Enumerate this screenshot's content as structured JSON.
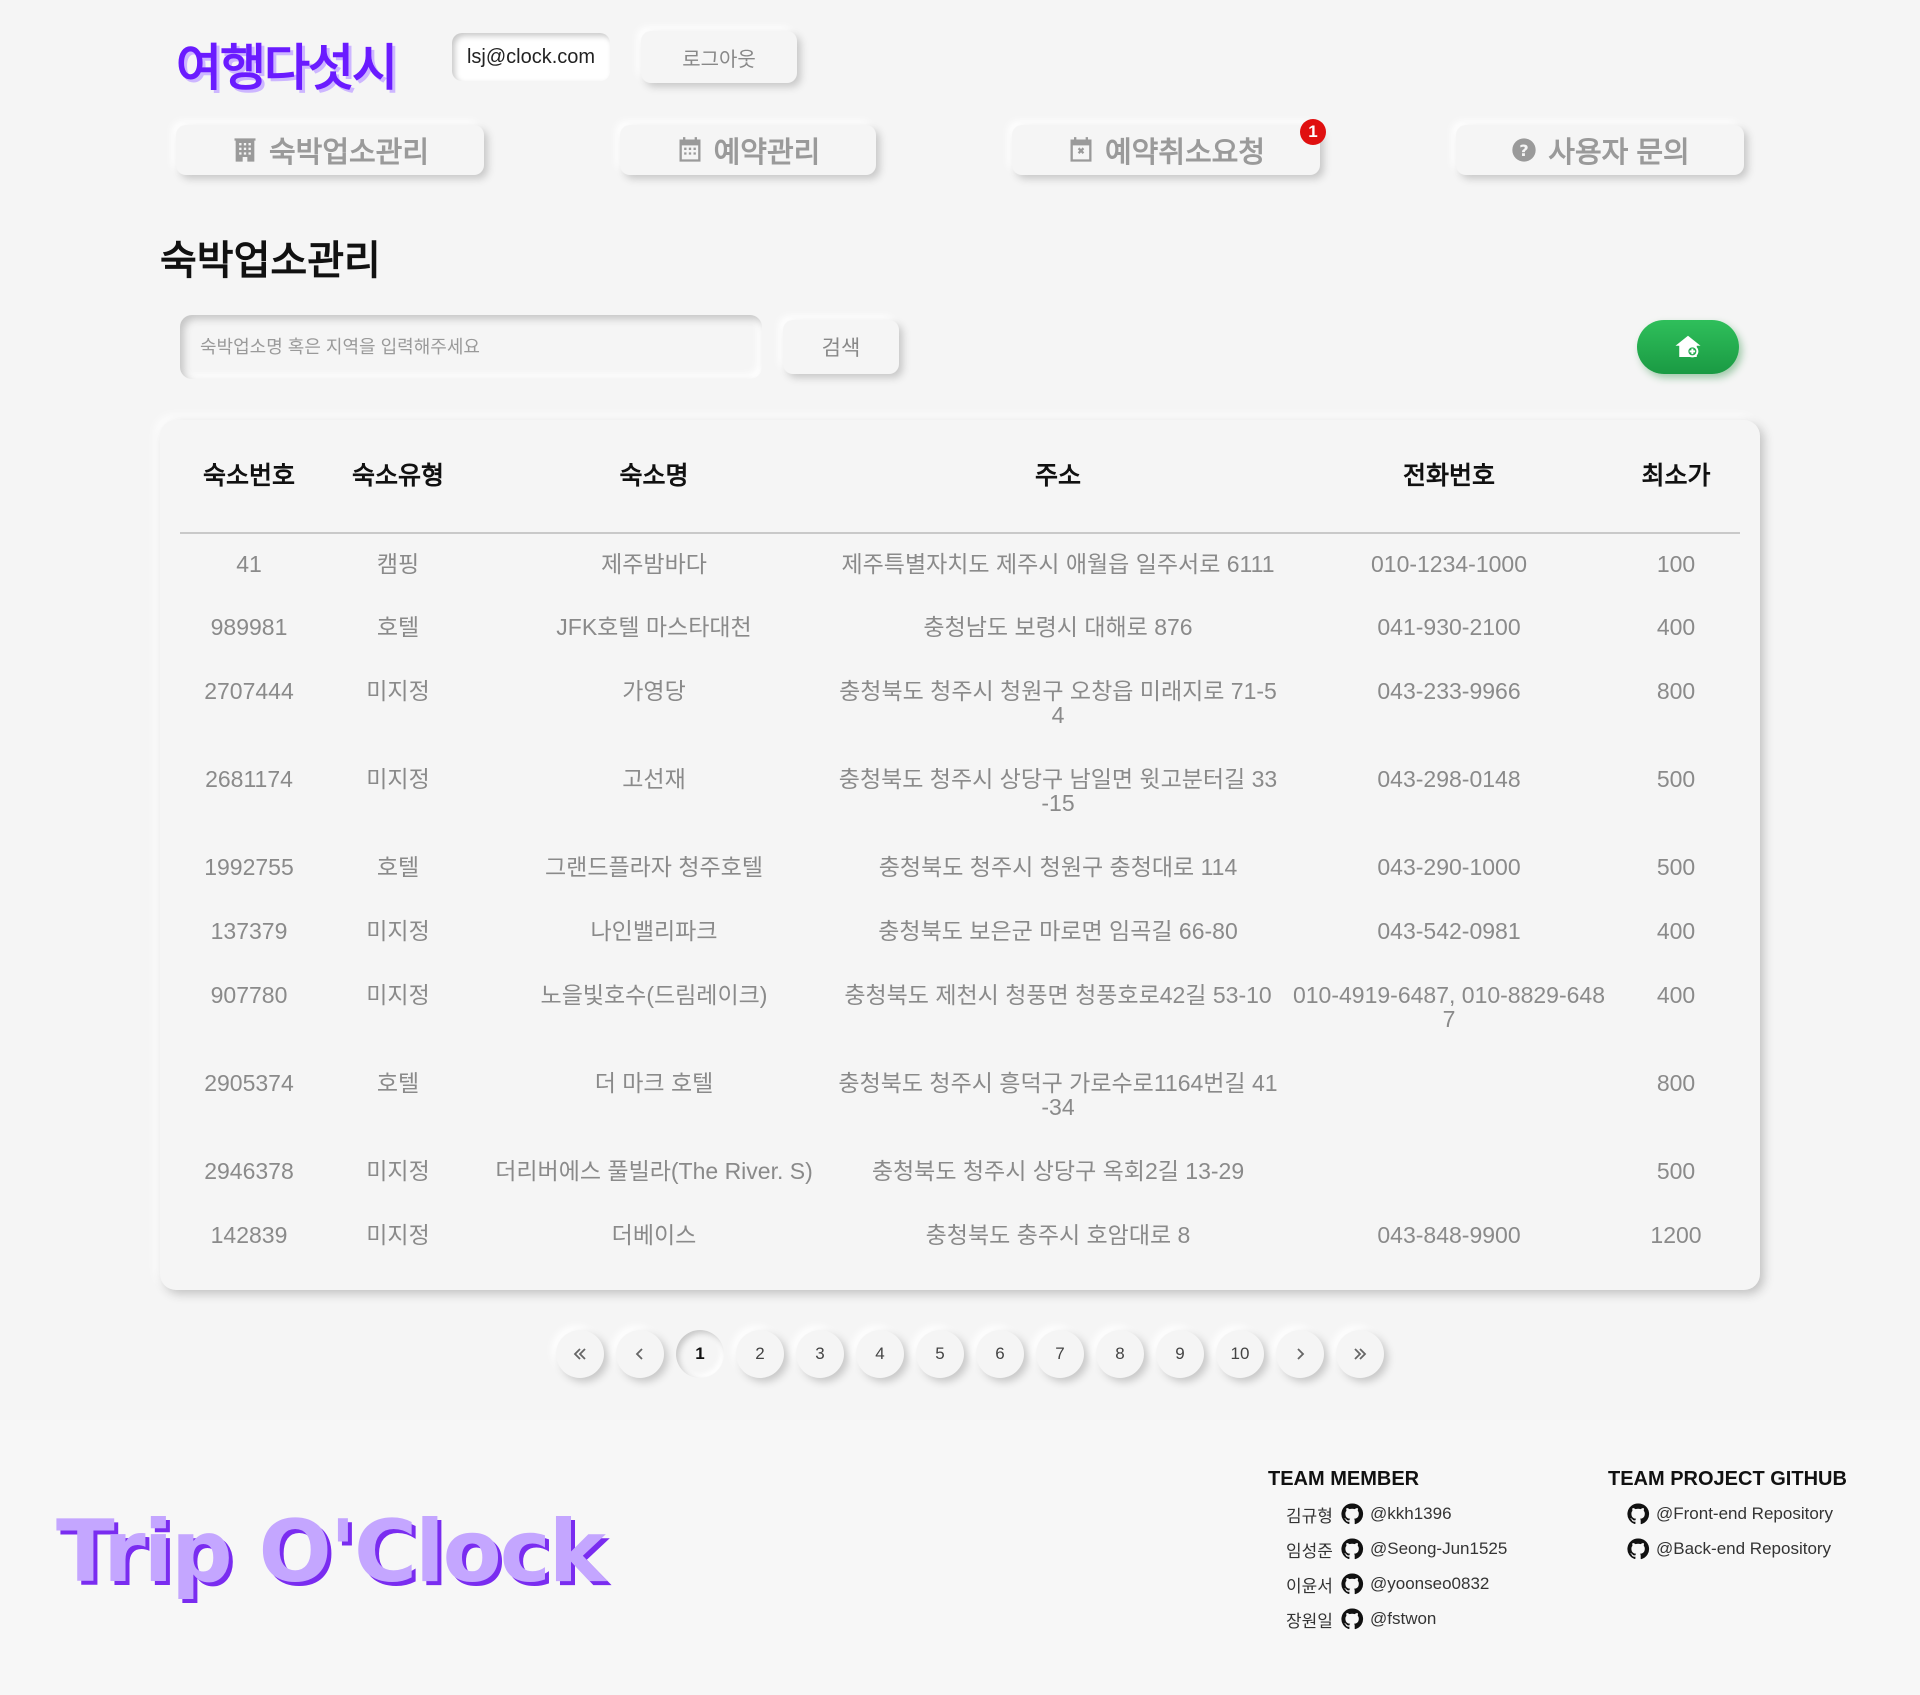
{
  "header": {
    "logo": "여행다섯시",
    "email": "lsj@clock.com",
    "logout_label": "로그아웃"
  },
  "nav": {
    "items": [
      {
        "label": "숙박업소관리",
        "icon": "building-icon"
      },
      {
        "label": "예약관리",
        "icon": "calendar-icon"
      },
      {
        "label": "예약취소요청",
        "icon": "calendar-x-icon"
      },
      {
        "label": "사용자 문의",
        "icon": "question-circle-icon"
      }
    ],
    "cancel_badge": "1"
  },
  "main": {
    "title": "숙박업소관리",
    "search": {
      "placeholder": "숙박업소명 혹은 지역을 입력해주세요",
      "value": "",
      "button_label": "검색"
    },
    "add_button_icon": "house-plus-icon"
  },
  "table": {
    "columns": [
      "숙소번호",
      "숙소유형",
      "숙소명",
      "주소",
      "전화번호",
      "최소가"
    ],
    "rows": [
      {
        "id": "41",
        "type": "캠핑",
        "name": "제주밤바다",
        "address": "제주특별자치도 제주시 애월읍 일주서로 6111",
        "phone": "010-1234-1000",
        "price": "100"
      },
      {
        "id": "989981",
        "type": "호텔",
        "name": "JFK호텔 마스타대천",
        "address": "충청남도 보령시 대해로 876",
        "phone": "041-930-2100",
        "price": "400"
      },
      {
        "id": "2707444",
        "type": "미지정",
        "name": "가영당",
        "address": "충청북도 청주시 청원구 오창읍 미래지로 71-54",
        "phone": "043-233-9966",
        "price": "800"
      },
      {
        "id": "2681174",
        "type": "미지정",
        "name": "고선재",
        "address": "충청북도 청주시 상당구 남일면 윗고분터길 33-15",
        "phone": "043-298-0148",
        "price": "500"
      },
      {
        "id": "1992755",
        "type": "호텔",
        "name": "그랜드플라자 청주호텔",
        "address": "충청북도 청주시 청원구 충청대로 114",
        "phone": "043-290-1000",
        "price": "500"
      },
      {
        "id": "137379",
        "type": "미지정",
        "name": "나인밸리파크",
        "address": "충청북도 보은군 마로면 임곡길 66-80",
        "phone": "043-542-0981",
        "price": "400"
      },
      {
        "id": "907780",
        "type": "미지정",
        "name": "노을빛호수(드림레이크)",
        "address": "충청북도 제천시 청풍면 청풍호로42길 53-10",
        "phone": "010-4919-6487, 010-8829-6487",
        "price": "400"
      },
      {
        "id": "2905374",
        "type": "호텔",
        "name": "더 마크 호텔",
        "address": "충청북도 청주시 흥덕구 가로수로1164번길 41-34",
        "phone": "",
        "price": "800"
      },
      {
        "id": "2946378",
        "type": "미지정",
        "name": "더리버에스 풀빌라(The River. S)",
        "address": "충청북도 청주시 상당구 옥회2길 13-29",
        "phone": "",
        "price": "500"
      },
      {
        "id": "142839",
        "type": "미지정",
        "name": "더베이스",
        "address": "충청북도 충주시 호암대로 8",
        "phone": "043-848-9900",
        "price": "1200"
      }
    ]
  },
  "pagination": {
    "first_icon": "double-chevron-left-icon",
    "prev_icon": "chevron-left-icon",
    "pages": [
      "1",
      "2",
      "3",
      "4",
      "5",
      "6",
      "7",
      "8",
      "9",
      "10"
    ],
    "current": "1",
    "next_icon": "chevron-right-icon",
    "last_icon": "double-chevron-right-icon"
  },
  "footer": {
    "logo": "Trip O'Clock",
    "team_member_title": "TEAM MEMBER",
    "members": [
      {
        "name": "김규형",
        "handle": "@kkh1396"
      },
      {
        "name": "임성준",
        "handle": "@Seong-Jun1525"
      },
      {
        "name": "이윤서",
        "handle": "@yoonseo0832"
      },
      {
        "name": "장원일",
        "handle": "@fstwon"
      }
    ],
    "github_title": "TEAM PROJECT GITHUB",
    "repos": [
      "@Front-end Repository",
      "@Back-end Repository"
    ]
  },
  "colors": {
    "brand_purple": "#6a1bff",
    "add_green": "#1fa84b",
    "badge_red": "#e01010",
    "background": "#f5f5f5"
  }
}
